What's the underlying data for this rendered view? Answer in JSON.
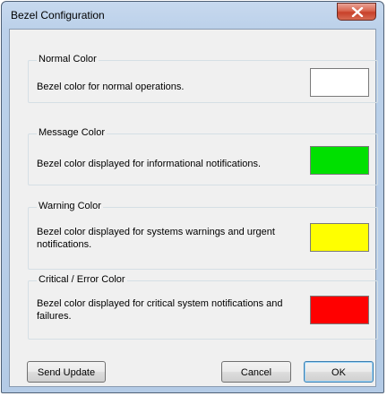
{
  "window": {
    "title": "Bezel Configuration"
  },
  "groups": [
    {
      "title": "Normal Color",
      "description": "Bezel color for normal operations.",
      "color": "#ffffff"
    },
    {
      "title": "Message Color",
      "description": "Bezel color displayed for informational notifications.",
      "color": "#00e000"
    },
    {
      "title": "Warning Color",
      "description": "Bezel color displayed for systems warnings and urgent notifications.",
      "color": "#ffff00"
    },
    {
      "title": "Critical / Error Color",
      "description": "Bezel color displayed for critical system notifications and failures.",
      "color": "#ff0000"
    }
  ],
  "buttons": {
    "send_update": "Send Update",
    "cancel": "Cancel",
    "ok": "OK"
  }
}
